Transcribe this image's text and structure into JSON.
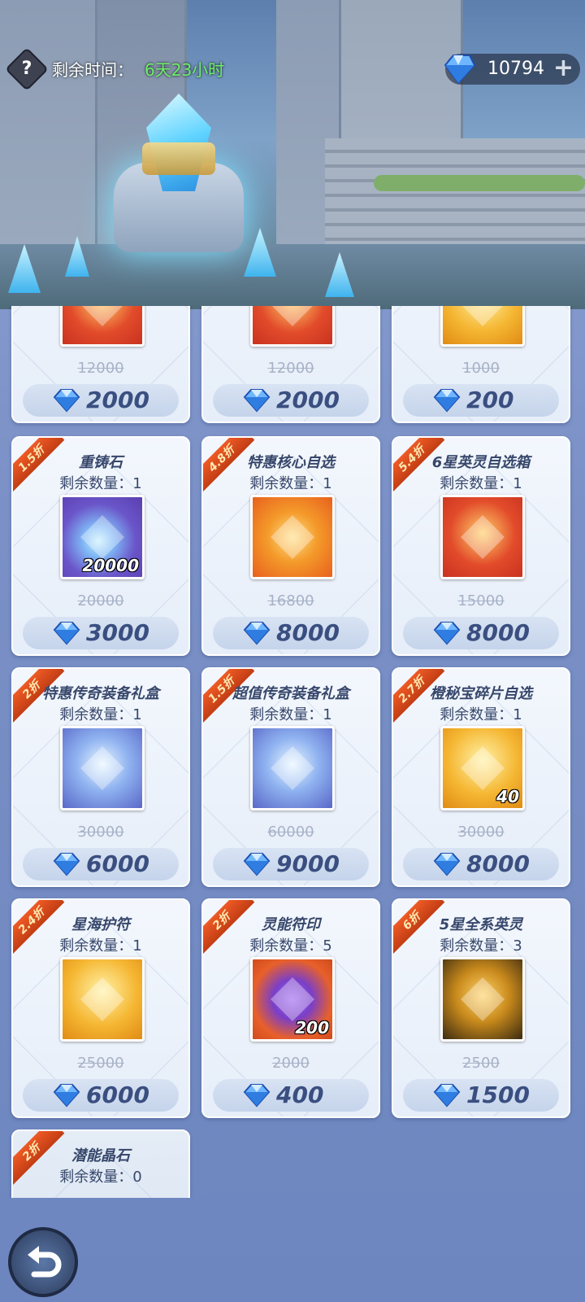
{
  "header": {
    "help_symbol": "?",
    "time_label": "剩余时间：",
    "time_value": "6天23小时",
    "currency_amount": "10794",
    "currency_plus": "+"
  },
  "colors": {
    "accent": "#3a4f80",
    "time_green": "#6ef06a",
    "ribbon": "#e0501e"
  },
  "top_row": [
    {
      "orig": "12000",
      "price": "2000",
      "icon": "orb-icon"
    },
    {
      "orig": "12000",
      "price": "2000",
      "icon": "orb-icon"
    },
    {
      "orig": "1000",
      "price": "200",
      "icon": "chest-icon"
    }
  ],
  "items": [
    {
      "discount": "1.5折",
      "name": "重铸石",
      "remaining": "剩余数量：1",
      "qty": "20000",
      "orig": "20000",
      "price": "3000",
      "icon": "crystal-icon"
    },
    {
      "discount": "4.8折",
      "name": "特惠核心自选",
      "remaining": "剩余数量：1",
      "qty": "",
      "orig": "16800",
      "price": "8000",
      "icon": "card-icon"
    },
    {
      "discount": "5.4折",
      "name": "6星英灵自选箱",
      "remaining": "剩余数量：1",
      "qty": "",
      "orig": "15000",
      "price": "8000",
      "icon": "helmet-icon"
    },
    {
      "discount": "2折",
      "name": "特惠传奇装备礼盒",
      "remaining": "剩余数量：1",
      "qty": "",
      "orig": "30000",
      "price": "6000",
      "icon": "armor-icon"
    },
    {
      "discount": "1.5折",
      "name": "超值传奇装备礼盒",
      "remaining": "剩余数量：1",
      "qty": "",
      "orig": "60000",
      "price": "9000",
      "icon": "armor-icon"
    },
    {
      "discount": "2.7折",
      "name": "橙秘宝碎片自选",
      "remaining": "剩余数量：1",
      "qty": "40",
      "orig": "30000",
      "price": "8000",
      "icon": "treasure-box-icon"
    },
    {
      "discount": "2.4折",
      "name": "星海护符",
      "remaining": "剩余数量：1",
      "qty": "",
      "orig": "25000",
      "price": "6000",
      "icon": "amulet-icon"
    },
    {
      "discount": "2折",
      "name": "灵能符印",
      "remaining": "剩余数量：5",
      "qty": "200",
      "orig": "2000",
      "price": "400",
      "icon": "rune-icon"
    },
    {
      "discount": "6折",
      "name": "5星全系英灵",
      "remaining": "剩余数量：3",
      "qty": "",
      "orig": "2500",
      "price": "1500",
      "icon": "hero-mask-icon"
    }
  ],
  "partial_item": {
    "discount": "2折",
    "name": "潜能晶石",
    "remaining": "剩余数量：0"
  }
}
